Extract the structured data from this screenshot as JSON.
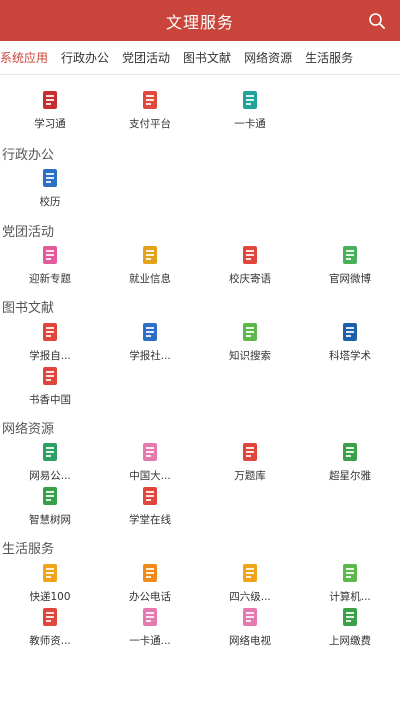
{
  "header": {
    "title": "文理服务"
  },
  "tabs": [
    "系统应用",
    "行政办公",
    "党团活动",
    "图书文献",
    "网络资源",
    "生活服务"
  ],
  "sections": [
    {
      "title": "",
      "items": [
        {
          "label": "学习通",
          "icon": "xuexitong-icon",
          "color": "#c62f2f"
        },
        {
          "label": "支付平台",
          "icon": "payment-icon",
          "color": "#e04a3d"
        },
        {
          "label": "一卡通",
          "icon": "campus-card-icon",
          "color": "#1fa39a"
        }
      ]
    },
    {
      "title": "行政办公",
      "items": [
        {
          "label": "校历",
          "icon": "calendar-icon",
          "color": "#2d6fc5"
        }
      ]
    },
    {
      "title": "党团活动",
      "items": [
        {
          "label": "迎新专题",
          "icon": "house-icon",
          "color": "#e35b9a"
        },
        {
          "label": "就业信息",
          "icon": "graduation-cap-icon",
          "color": "#e3a21a"
        },
        {
          "label": "校庆寄语",
          "icon": "message-icon",
          "color": "#e0463b"
        },
        {
          "label": "官网微博",
          "icon": "search-globe-icon",
          "color": "#49b05a"
        }
      ]
    },
    {
      "title": "图书文献",
      "items": [
        {
          "label": "学报自...",
          "icon": "journal-icon",
          "color": "#e0463b"
        },
        {
          "label": "学报社...",
          "icon": "journal-social-icon",
          "color": "#2d6fc5"
        },
        {
          "label": "知识搜索",
          "icon": "knowledge-search-icon",
          "color": "#5cb84a"
        },
        {
          "label": "科塔学术",
          "icon": "science-logo-icon",
          "color": "#1f5fa8"
        },
        {
          "label": "书香中国",
          "icon": "open-book-icon",
          "color": "#e0463b"
        }
      ]
    },
    {
      "title": "网络资源",
      "items": [
        {
          "label": "网易公...",
          "icon": "open-course-icon",
          "color": "#2ea063"
        },
        {
          "label": "中国大...",
          "icon": "mooc-cap-icon",
          "color": "#e57ab0"
        },
        {
          "label": "万题库",
          "icon": "question-bank-icon",
          "color": "#e0463b"
        },
        {
          "label": "超星尔雅",
          "icon": "chaoxing-icon",
          "color": "#3aa14a"
        },
        {
          "label": "智慧树网",
          "icon": "wisdom-tree-icon",
          "color": "#39a04a"
        },
        {
          "label": "学堂在线",
          "icon": "xuetang-cap-icon",
          "color": "#e0463b"
        }
      ]
    },
    {
      "title": "生活服务",
      "items": [
        {
          "label": "快递100",
          "icon": "courier-icon",
          "color": "#f0a31b"
        },
        {
          "label": "办公电话",
          "icon": "phone-icon",
          "color": "#f08a1b"
        },
        {
          "label": "四六级...",
          "icon": "cet-exam-icon",
          "color": "#f0a31b"
        },
        {
          "label": "计算机...",
          "icon": "computer-exam-icon",
          "color": "#5cb84a"
        },
        {
          "label": "教师资...",
          "icon": "teacher-cert-icon",
          "color": "#e0463b"
        },
        {
          "label": "一卡通...",
          "icon": "card-money-icon",
          "color": "#e57ab0"
        },
        {
          "label": "网络电视",
          "icon": "tv-icon",
          "color": "#e57ab0"
        },
        {
          "label": "上网缴费",
          "icon": "network-pay-icon",
          "color": "#3aa14a"
        }
      ]
    }
  ]
}
